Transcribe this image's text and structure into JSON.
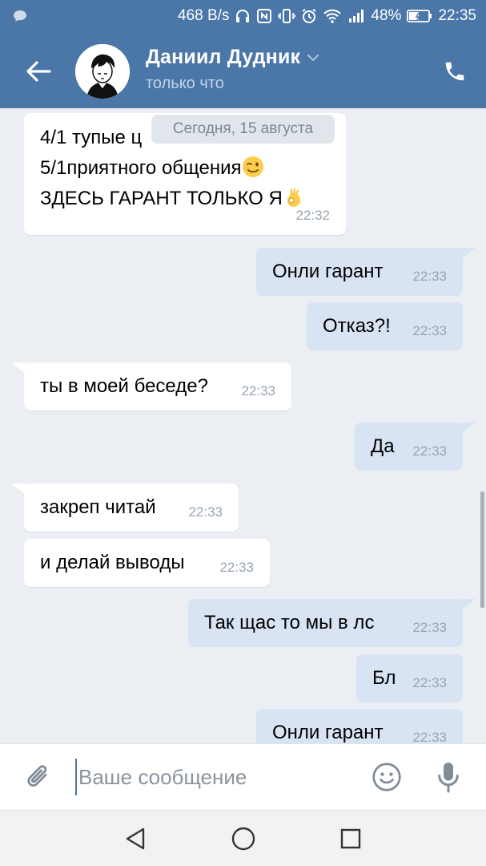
{
  "status_bar": {
    "net_speed": "468 B/s",
    "battery": "48%",
    "time": "22:35",
    "icons": [
      "message-icon",
      "headphones-icon",
      "nfc-icon",
      "vibrate-icon",
      "alarm-icon",
      "wifi-icon",
      "signal-icon",
      "battery-icon"
    ]
  },
  "header": {
    "contact_name": "Даниил Дудник",
    "status": "только что"
  },
  "date_separator": "Сегодня, 15 августа",
  "messages": [
    {
      "dir": "in",
      "lines": [
        "4/1 тупые ц",
        "5/1приятного общения",
        "ЗДЕСЬ ГАРАНТ ТОЛЬКО Я"
      ],
      "emojis": [
        "wink",
        "ok-hand"
      ],
      "time": "22:32"
    },
    {
      "dir": "out",
      "text": "Онли гарант",
      "time": "22:33"
    },
    {
      "dir": "out",
      "text": "Отказ?!",
      "time": "22:33"
    },
    {
      "dir": "in",
      "text": "ты в моей беседе?",
      "time": "22:33"
    },
    {
      "dir": "out",
      "text": "Да",
      "time": "22:33"
    },
    {
      "dir": "in",
      "text": "закреп читай",
      "time": "22:33"
    },
    {
      "dir": "in",
      "text": "и делай выводы",
      "time": "22:33"
    },
    {
      "dir": "out",
      "text": "Так щас то мы в лс",
      "time": "22:33"
    },
    {
      "dir": "out",
      "text": "Бл",
      "time": "22:33"
    },
    {
      "dir": "out",
      "text": "Онли гарант",
      "time": "22:33"
    }
  ],
  "composer": {
    "placeholder": "Ваше сообщение",
    "value": ""
  },
  "colors": {
    "header_bg": "#4a76a8",
    "chat_bg": "#ebeef2",
    "bubble_in": "#ffffff",
    "bubble_out": "#d8e4f3",
    "time_text": "#97a4b2"
  }
}
